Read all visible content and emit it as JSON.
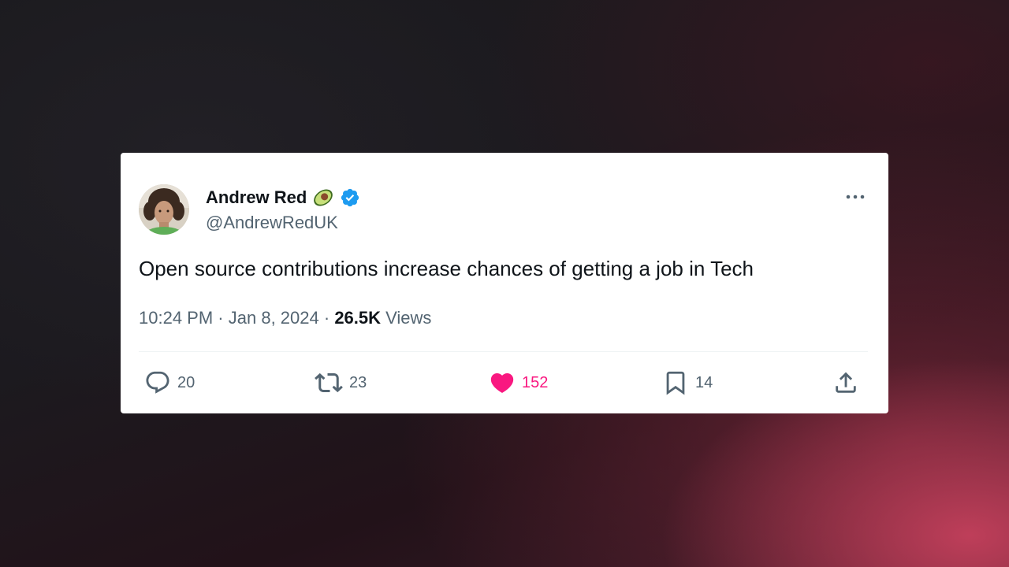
{
  "tweet": {
    "author": {
      "name": "Andrew Red",
      "name_emoji": "avocado-icon",
      "verified": true,
      "handle": "@AndrewRedUK"
    },
    "text": "Open source contributions increase chances of getting a job in Tech",
    "meta": {
      "time": "10:24 PM",
      "separator": "·",
      "date": "Jan 8, 2024",
      "views_count": "26.5K",
      "views_label": "Views"
    },
    "actions": {
      "replies": "20",
      "retweets": "23",
      "likes": "152",
      "bookmarks": "14"
    }
  },
  "icons": {
    "reply": "reply-icon",
    "retweet": "retweet-icon",
    "like": "heart-icon",
    "bookmark": "bookmark-icon",
    "share": "share-icon",
    "more": "more-options-icon",
    "verified": "verified-badge-icon"
  },
  "colors": {
    "text_primary": "#0f1419",
    "text_secondary": "#536471",
    "like_pink": "#f91880",
    "verified_blue": "#1d9bf0",
    "card_bg": "#ffffff"
  }
}
